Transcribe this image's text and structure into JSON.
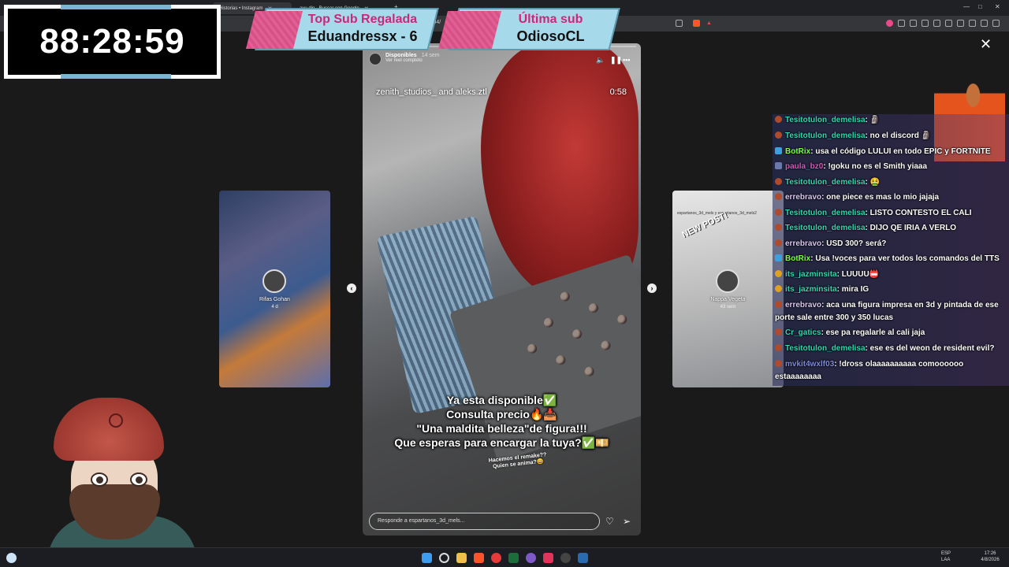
{
  "browser": {
    "tabs": [
      {
        "label": "Historias • Instagram",
        "active": true
      },
      {
        "label": "ayu dip - Buscar con Google",
        "active": false
      }
    ],
    "url_fragment": "3732194/",
    "window_controls": [
      "—",
      "□",
      "✕"
    ]
  },
  "timer": {
    "value": "88:28:59"
  },
  "banners": {
    "top_sub": {
      "title": "Top Sub Regalada",
      "name": "Eduandressx - 6"
    },
    "last_sub": {
      "title": "Última sub",
      "name": "OdiosoCL"
    }
  },
  "story": {
    "username": "Disponibles",
    "time_ago": "14 sem",
    "subtitle": "Ver reel completo",
    "reel_title": "zenith_studios_ and aleks.ztl",
    "reel_time": "0:58",
    "progress": 0.0,
    "caption_lines": [
      "Ya esta disponible✅",
      "Consulta precio🔥📥",
      "\"Una maldita belleza\"de figura!!!",
      "Que esperas para encargar la tuya?✅💴"
    ],
    "small_caption": [
      "Hacemos el remake??",
      "Quien se anima?😄"
    ],
    "reply_placeholder": "Responde a espartanos_3d_mels..."
  },
  "side_stories": {
    "left": {
      "name": "Rifas Gohan",
      "time": "4 d"
    },
    "right": {
      "name": "Nappa Vegeta",
      "time": "43 sem",
      "header": "espartanos_3d_mels y espartanos_3d_mels2",
      "badge": "NEW POST!"
    }
  },
  "chat": [
    {
      "user": "Tesitotulon_demelisa",
      "color": "#35d6b0",
      "badge": "user",
      "text": ": 🗿"
    },
    {
      "user": "Tesitotulon_demelisa",
      "color": "#35d6b0",
      "badge": "user",
      "text": ": no el discord 🗿"
    },
    {
      "user": "BotRix",
      "color": "#7cff4a",
      "badge": "mod",
      "text": ": usa el código LULUI en todo EPIC y FORTNITE"
    },
    {
      "user": "paula_bz0",
      "color": "#d85ab8",
      "badge": "sub",
      "text": ": !goku no es el Smith yiaaa"
    },
    {
      "user": "Tesitotulon_demelisa",
      "color": "#35d6b0",
      "badge": "user",
      "text": ": 🤮"
    },
    {
      "user": "errebravo",
      "color": "#d8c8ee",
      "badge": "user",
      "text": ": one piece es mas lo mio jajaja"
    },
    {
      "user": "Tesitotulon_demelisa",
      "color": "#35d6b0",
      "badge": "user",
      "text": ": LISTO CONTESTO EL CALI"
    },
    {
      "user": "Tesitotulon_demelisa",
      "color": "#35d6b0",
      "badge": "user",
      "text": ": DIJO QE IRIA A VERLO"
    },
    {
      "user": "errebravo",
      "color": "#d8c8ee",
      "badge": "user",
      "text": ": USD 300? será?"
    },
    {
      "user": "BotRix",
      "color": "#7cff4a",
      "badge": "mod",
      "text": ": Usa !voces para ver todos los comandos del TTS"
    },
    {
      "user": "its_jazminsita",
      "color": "#35d6b0",
      "badge": "vip",
      "text": ": LUUUU📛"
    },
    {
      "user": "its_jazminsita",
      "color": "#35d6b0",
      "badge": "vip",
      "text": ": mira IG"
    },
    {
      "user": "errebravo",
      "color": "#d8c8ee",
      "badge": "user",
      "text": ": aca una figura impresa en 3d y pintada de ese porte sale entre 300 y 350 lucas"
    },
    {
      "user": "Cr_gatics",
      "color": "#35d6b0",
      "badge": "user",
      "text": ": ese pa regalarle al cali jaja"
    },
    {
      "user": "Tesitotulon_demelisa",
      "color": "#35d6b0",
      "badge": "user",
      "text": ": ese es del weon de resident evil?"
    },
    {
      "user": "mvkit4wxlf03",
      "color": "#7f8ad8",
      "badge": "user",
      "text": ": !dross olaaaaaaaaaa comoooooo estaaaaaaaa"
    }
  ],
  "taskbar": {
    "lang": "ESP",
    "region": "LAA",
    "time": "17:26",
    "date": "4/8/2026"
  },
  "icons": {
    "close": "close-icon",
    "prev": "chevron-left-icon",
    "next": "chevron-right-icon",
    "like": "heart-icon",
    "send": "send-icon",
    "pause": "pause-icon",
    "volume": "volume-icon",
    "more": "more-icon"
  },
  "colors": {
    "banner_bg": "#a6d9ea",
    "banner_pink": "#e06093",
    "banner_title": "#d0257a",
    "username_teal": "#35d6b0",
    "bot_green": "#7cff4a"
  }
}
